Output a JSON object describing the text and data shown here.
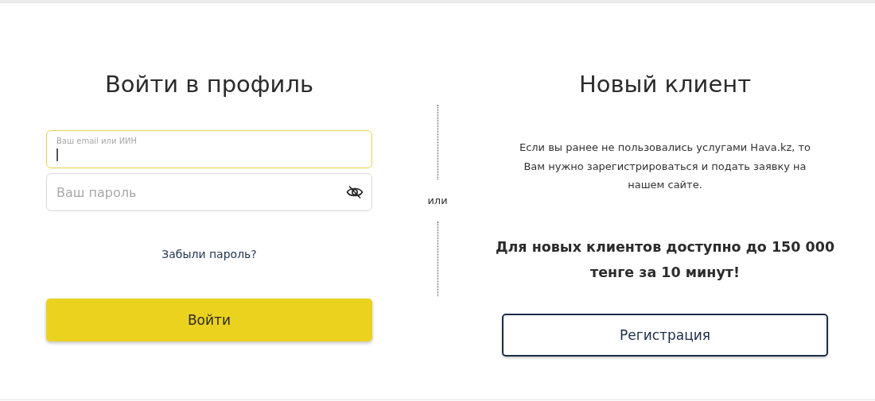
{
  "login": {
    "title": "Войти в профиль",
    "fields": [
      {
        "kind": "floating",
        "label": "Ваш email или ИИН",
        "focused": true
      },
      {
        "kind": "password",
        "placeholder": "Ваш пароль",
        "focused": false
      }
    ],
    "forgot_link": "Забыли пароль?",
    "submit": "Войти"
  },
  "divider": {
    "label": "или"
  },
  "register": {
    "title": "Новый клиент",
    "description": "Если вы ранее не пользовались услугами Hava.kz, то Вам нужно зарегистрироваться и подать заявку на нашем сайте.",
    "promo": "Для новых клиентов доступно до 150 000 тенге за 10 минут!",
    "button": "Регистрация"
  }
}
